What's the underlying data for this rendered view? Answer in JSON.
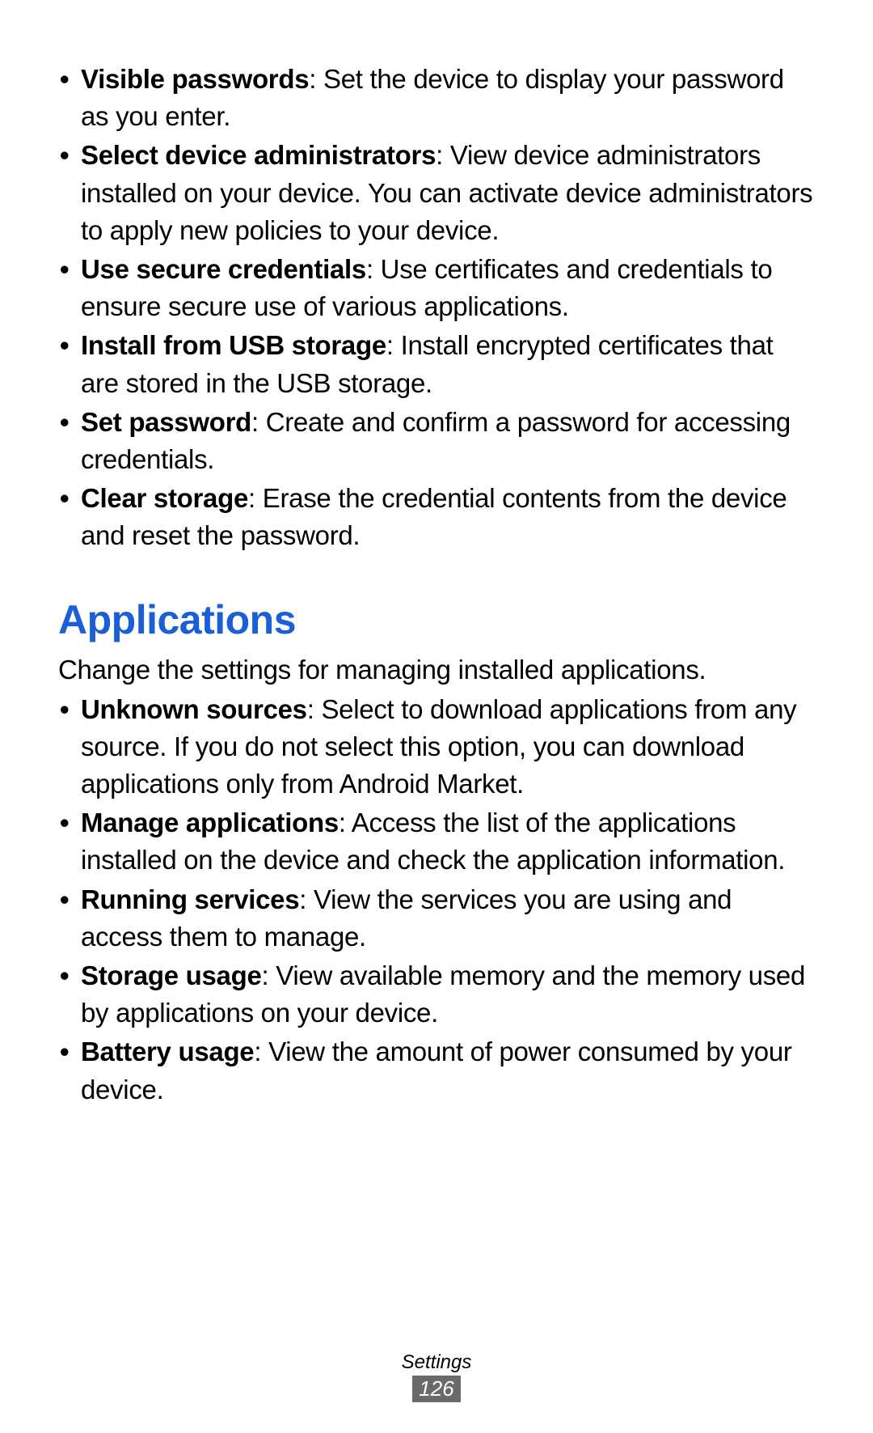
{
  "section1": {
    "items": [
      {
        "term": "Visible passwords",
        "desc": ": Set the device to display your password as you enter."
      },
      {
        "term": "Select device administrators",
        "desc": ": View device administrators installed on your device. You can activate device administrators to apply new policies to your device."
      },
      {
        "term": "Use secure credentials",
        "desc": ": Use certificates and credentials to ensure secure use of various applications."
      },
      {
        "term": "Install from USB storage",
        "desc": ": Install encrypted certificates that are stored in the USB storage."
      },
      {
        "term": "Set password",
        "desc": ": Create and confirm a password for accessing credentials."
      },
      {
        "term": "Clear storage",
        "desc": ": Erase the credential contents from the device and reset the password."
      }
    ]
  },
  "section2": {
    "heading": "Applications",
    "intro": "Change the settings for managing installed applications.",
    "items": [
      {
        "term": "Unknown sources",
        "desc": ": Select to download applications from any source. If you do not select this option, you can download applications only from Android Market."
      },
      {
        "term": "Manage applications",
        "desc": ": Access the list of the applications installed on the device and check the application information."
      },
      {
        "term": "Running services",
        "desc": ": View the services you are using and access them to manage."
      },
      {
        "term": "Storage usage",
        "desc": ": View available memory and the memory used by applications on your device."
      },
      {
        "term": "Battery usage",
        "desc": ": View the amount of power consumed by your device."
      }
    ]
  },
  "footer": {
    "label": "Settings",
    "page": "126"
  }
}
